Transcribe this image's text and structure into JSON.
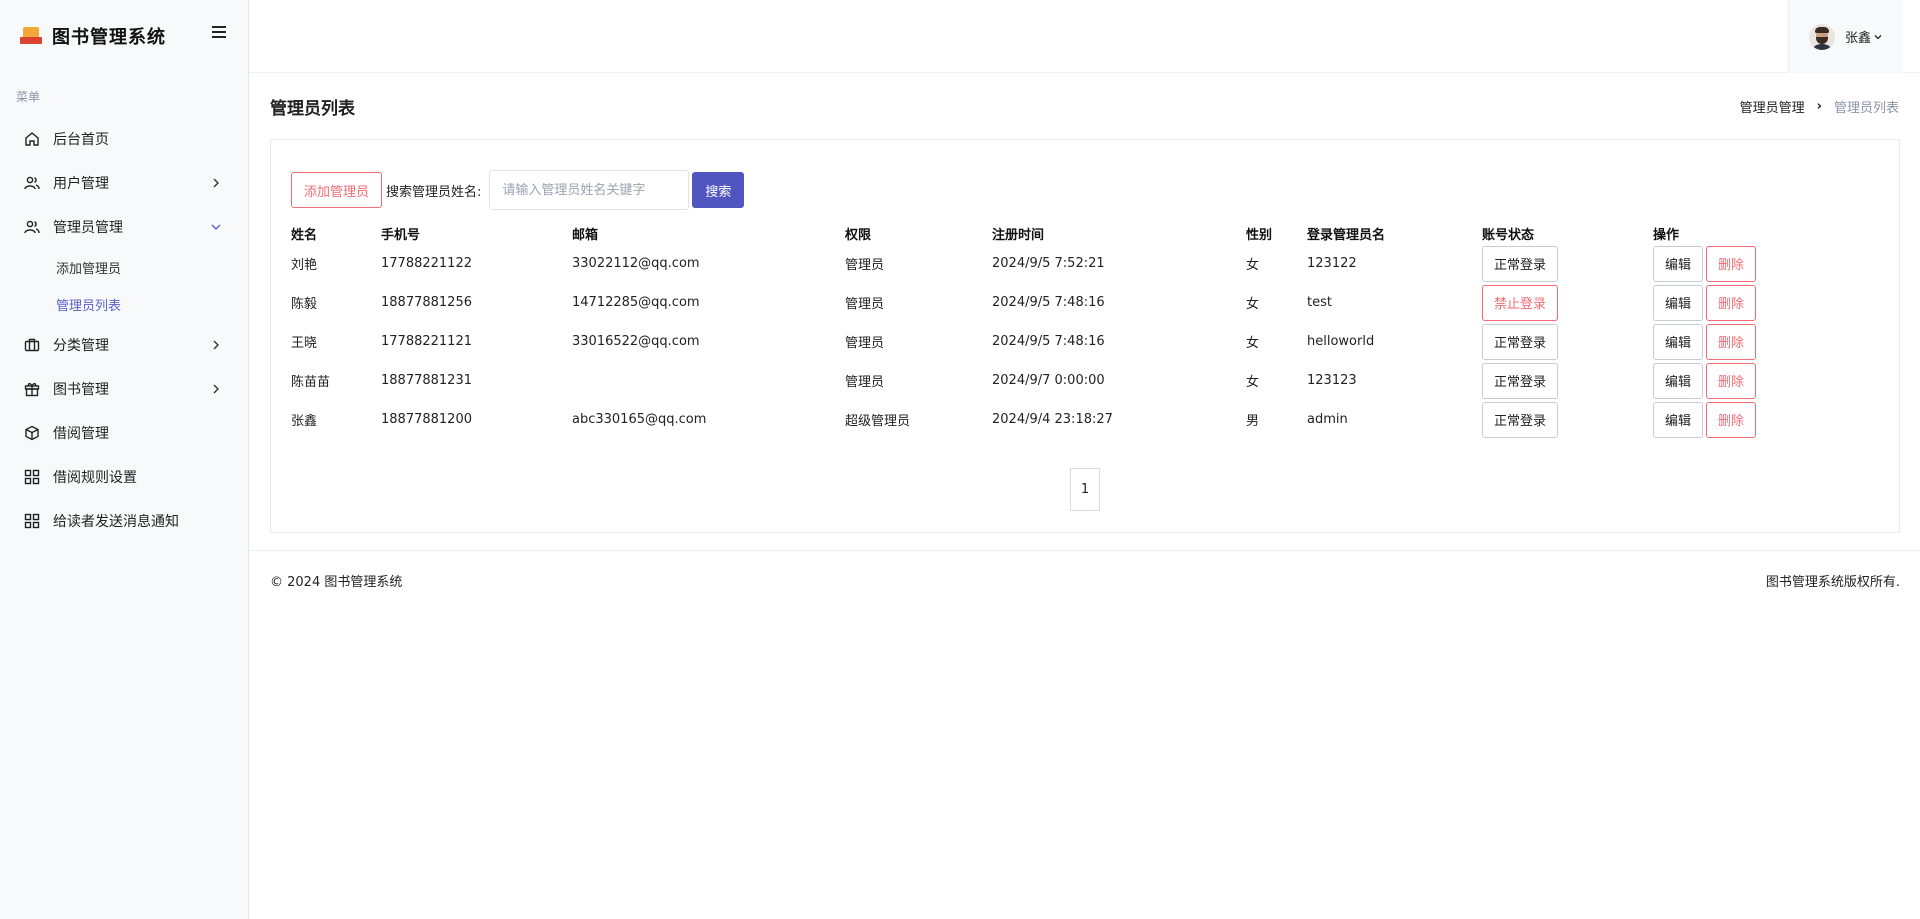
{
  "app": {
    "title": "图书管理系统"
  },
  "sidebar": {
    "caption": "菜单",
    "items": [
      {
        "label": "后台首页",
        "icon": "home-icon"
      },
      {
        "label": "用户管理",
        "icon": "users-icon"
      },
      {
        "label": "管理员管理",
        "icon": "users-icon",
        "expanded": true
      },
      {
        "label": "分类管理",
        "icon": "briefcase-icon"
      },
      {
        "label": "图书管理",
        "icon": "gift-icon"
      },
      {
        "label": "借阅管理",
        "icon": "box-icon"
      },
      {
        "label": "借阅规则设置",
        "icon": "grid-icon"
      },
      {
        "label": "给读者发送消息通知",
        "icon": "grid-icon"
      }
    ],
    "subitems": [
      {
        "label": "添加管理员"
      },
      {
        "label": "管理员列表",
        "active": true
      }
    ]
  },
  "header": {
    "user_name": "张鑫"
  },
  "page": {
    "title": "管理员列表",
    "breadcrumb": {
      "parent": "管理员管理",
      "separator": "›",
      "current": "管理员列表"
    }
  },
  "toolbar": {
    "add_label": "添加管理员",
    "search_label": "搜索管理员姓名:",
    "search_placeholder": "请输入管理员姓名关键字",
    "search_button": "搜索"
  },
  "table": {
    "columns": [
      "姓名",
      "手机号",
      "邮箱",
      "权限",
      "注册时间",
      "性别",
      "登录管理员名",
      "账号状态",
      "操作"
    ],
    "edit_label": "编辑",
    "delete_label": "删除",
    "rows": [
      {
        "name": "刘艳",
        "phone": "17788221122",
        "email": "33022112@qq.com",
        "role": "管理员",
        "registered": "2024/9/5 7:52:21",
        "gender": "女",
        "login": "123122",
        "status": "正常登录",
        "banned": false
      },
      {
        "name": "陈毅",
        "phone": "18877881256",
        "email": "14712285@qq.com",
        "role": "管理员",
        "registered": "2024/9/5 7:48:16",
        "gender": "女",
        "login": "test",
        "status": "禁止登录",
        "banned": true
      },
      {
        "name": "王晓",
        "phone": "17788221121",
        "email": "33016522@qq.com",
        "role": "管理员",
        "registered": "2024/9/5 7:48:16",
        "gender": "女",
        "login": "helloworld",
        "status": "正常登录",
        "banned": false
      },
      {
        "name": "陈苗苗",
        "phone": "18877881231",
        "email": "",
        "role": "管理员",
        "registered": "2024/9/7 0:00:00",
        "gender": "女",
        "login": "123123",
        "status": "正常登录",
        "banned": false
      },
      {
        "name": "张鑫",
        "phone": "18877881200",
        "email": "abc330165@qq.com",
        "role": "超级管理员",
        "registered": "2024/9/4 23:18:27",
        "gender": "男",
        "login": "admin",
        "status": "正常登录",
        "banned": false
      }
    ]
  },
  "pagination": {
    "current": "1"
  },
  "footer": {
    "left": "© 2024 图书管理系统",
    "right": "图书管理系统版权所有."
  },
  "colors": {
    "primary": "#5055c0",
    "danger": "#f36c73",
    "active_nav": "#5b5fc7",
    "sidebar_bg": "#f8f9fb"
  }
}
